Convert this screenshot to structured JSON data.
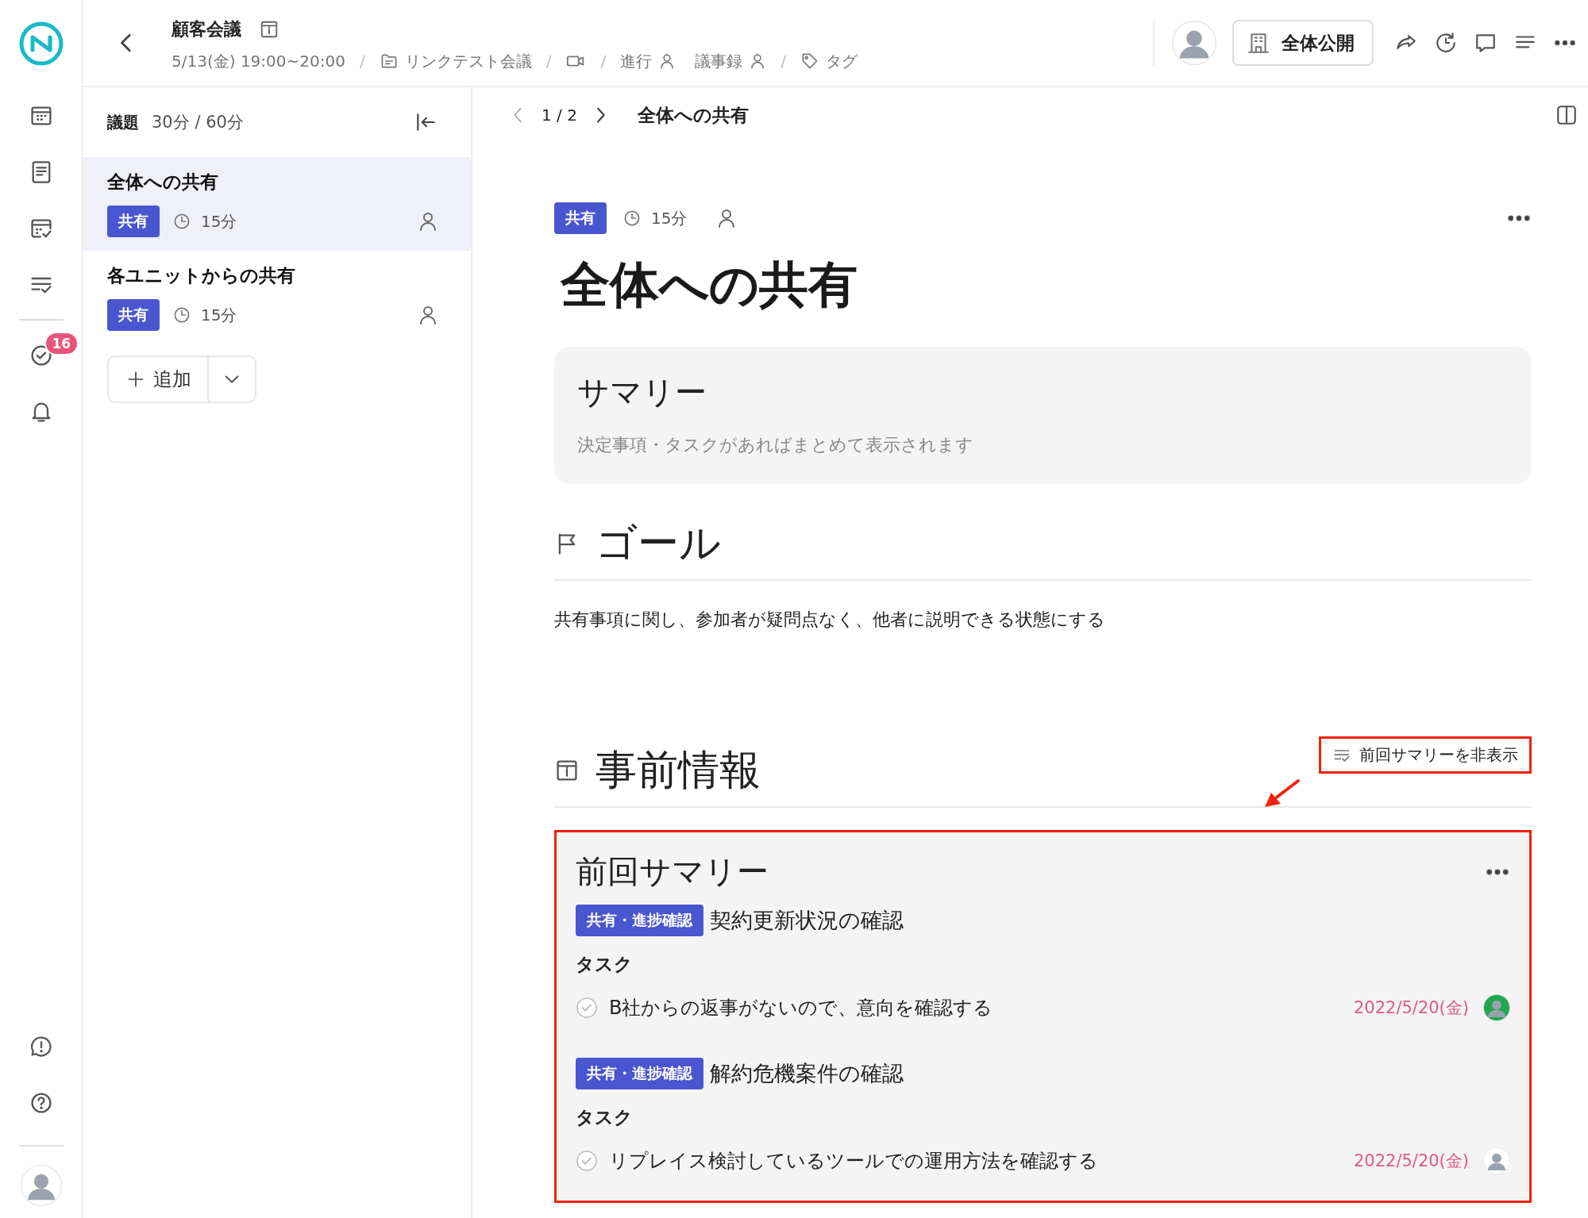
{
  "rail": {
    "badge": "16"
  },
  "header": {
    "title": "顧客会議",
    "datetime": "5/13(金) 19:00~20:00",
    "project": "リンクテスト会議",
    "facilitator_label": "進行",
    "minutes_label": "議事録",
    "tags_label": "タグ",
    "separators": [
      "/",
      "/",
      "/",
      "/"
    ],
    "visibility_button": "全体公開"
  },
  "agenda": {
    "label": "議題",
    "time_summary": "30分 / 60分",
    "add_button": "追加",
    "items": [
      {
        "title": "全体への共有",
        "tag": "共有",
        "duration": "15分",
        "selected": true
      },
      {
        "title": "各ユニットからの共有",
        "tag": "共有",
        "duration": "15分",
        "selected": false
      }
    ]
  },
  "pager": {
    "position": "1 / 2",
    "title": "全体への共有"
  },
  "topic": {
    "tag": "共有",
    "duration": "15分",
    "title": "全体への共有"
  },
  "summary": {
    "heading": "サマリー",
    "note": "決定事項・タスクがあればまとめて表示されます"
  },
  "goal": {
    "heading": "ゴール",
    "text": "共有事項に関し、参加者が疑問点なく、他者に説明できる状態にする"
  },
  "prior_info": {
    "heading": "事前情報",
    "toggle_button": {
      "label": "前回サマリーを非表示",
      "highlighted": true
    },
    "previous_summary": {
      "heading": "前回サマリー",
      "highlighted": true,
      "topics": [
        {
          "tag": "共有・進捗確認",
          "title": "契約更新状況の確認",
          "section_label": "タスク",
          "tasks": [
            {
              "text": "B社からの返事がないので、意向を確認する",
              "done": false,
              "due": "2022/5/20(金)"
            }
          ]
        },
        {
          "tag": "共有・進捗確認",
          "title": "解約危機案件の確認",
          "section_label": "タスク",
          "tasks": [
            {
              "text": "リプレイス検討しているツールでの運用方法を確認する",
              "done": false,
              "due": "2022/5/20(金)"
            }
          ]
        }
      ]
    }
  }
}
